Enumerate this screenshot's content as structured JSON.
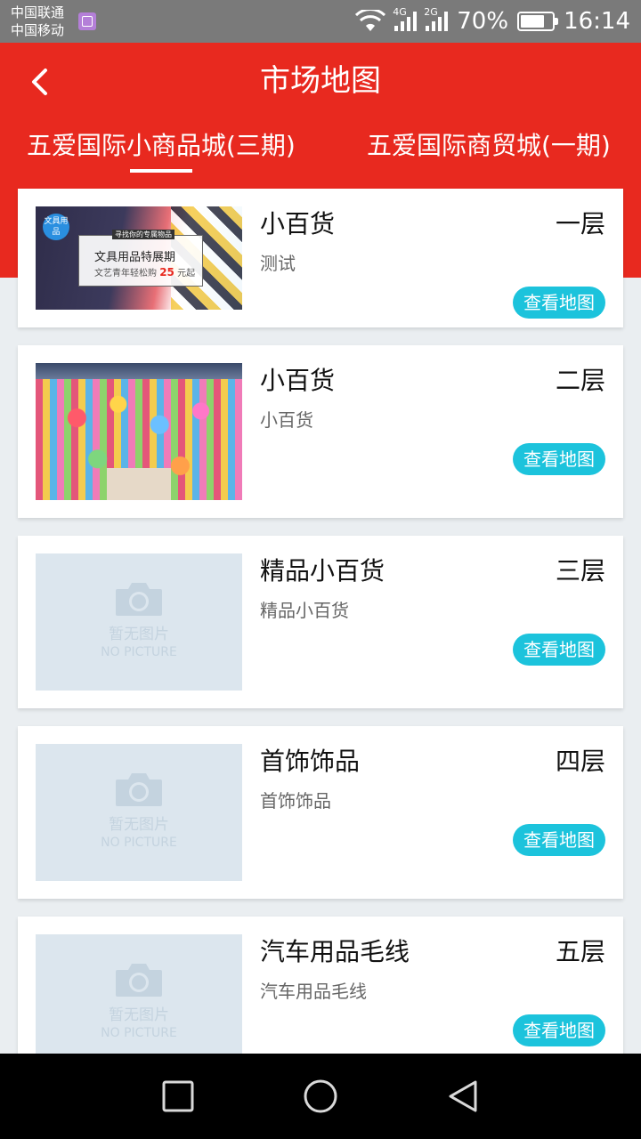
{
  "status_bar": {
    "carrier_1": "中国联通",
    "carrier_2": "中国移动",
    "net_1": "4G",
    "net_2": "2G",
    "battery": "70%",
    "time": "16:14"
  },
  "header": {
    "title": "市场地图",
    "tabs": [
      {
        "label": "五爱国际小商品城(三期)",
        "active": true
      },
      {
        "label": "五爱国际商贸城(一期)",
        "active": false
      }
    ]
  },
  "cards": [
    {
      "name": "小百货",
      "subtitle": "测试",
      "floor": "一层",
      "button": "查看地图",
      "thumb": "stationery-banner"
    },
    {
      "name": "小百货",
      "subtitle": "小百货",
      "floor": "二层",
      "button": "查看地图",
      "thumb": "toy-store-photo"
    },
    {
      "name": "精品小百货",
      "subtitle": "精品小百货",
      "floor": "三层",
      "button": "查看地图",
      "thumb": "no-picture"
    },
    {
      "name": "首饰饰品",
      "subtitle": "首饰饰品",
      "floor": "四层",
      "button": "查看地图",
      "thumb": "no-picture"
    },
    {
      "name": "汽车用品毛线",
      "subtitle": "汽车用品毛线",
      "floor": "五层",
      "button": "查看地图",
      "thumb": "no-picture"
    }
  ],
  "banner": {
    "badge": "文具用品",
    "tagline": "寻找你的专属物品",
    "headline": "文具用品特展期",
    "offer_prefix": "文艺青年轻松购",
    "offer_price": "25",
    "offer_suffix": "元起"
  },
  "placeholder": {
    "text_cn": "暂无图片",
    "text_en": "NO PICTURE"
  },
  "colors": {
    "header_red": "#e8291f",
    "button_cyan": "#1cc3dc",
    "background": "#eaeef1"
  }
}
